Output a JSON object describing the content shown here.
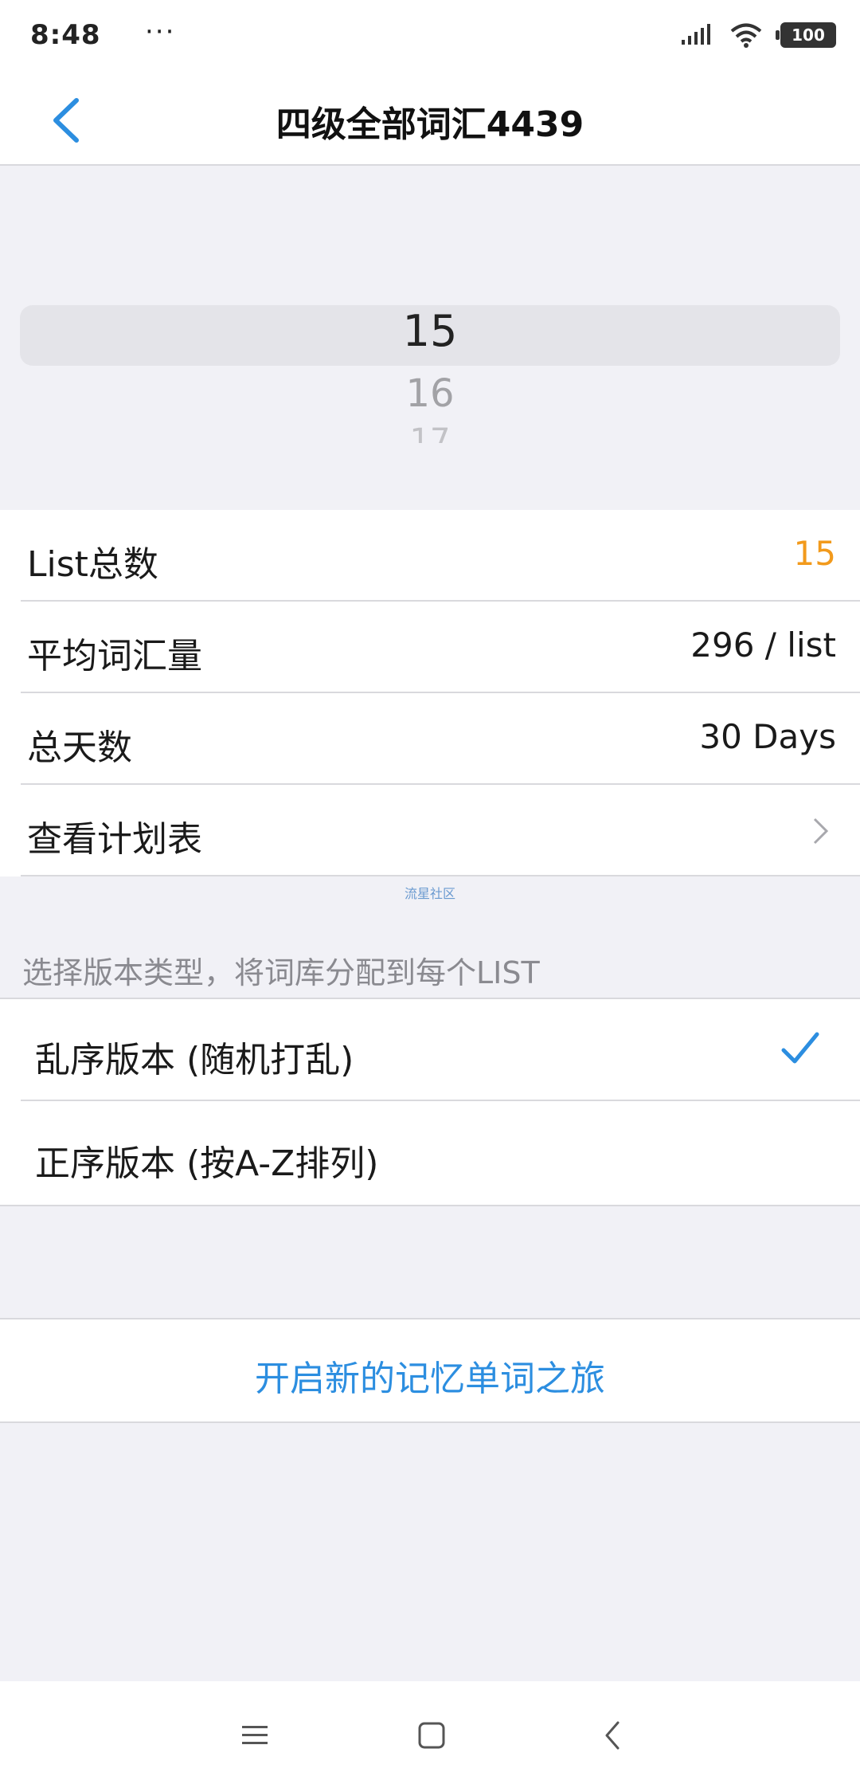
{
  "status": {
    "time": "8:48",
    "dots": "···",
    "battery": "100"
  },
  "header": {
    "title": "四级全部词汇4439"
  },
  "picker": {
    "selected": "15",
    "next": "16",
    "next2": "17"
  },
  "info_rows": [
    {
      "label": "List总数",
      "value": "15"
    },
    {
      "label": "平均词汇量",
      "value": "296 / list"
    },
    {
      "label": "总天数",
      "value": "30 Days"
    },
    {
      "label": "查看计划表",
      "value": ""
    }
  ],
  "watermark": "流星社区",
  "section_caption": "选择版本类型，将词库分配到每个LIST",
  "options": [
    {
      "label": "乱序版本 (随机打乱)",
      "selected": true
    },
    {
      "label": "正序版本 (按A-Z排列)",
      "selected": false
    }
  ],
  "action": {
    "label": "开启新的记忆单词之旅"
  },
  "colors": {
    "accent": "#2c8ee0",
    "highlight": "#f29a1c",
    "background": "#f1f1f6"
  }
}
